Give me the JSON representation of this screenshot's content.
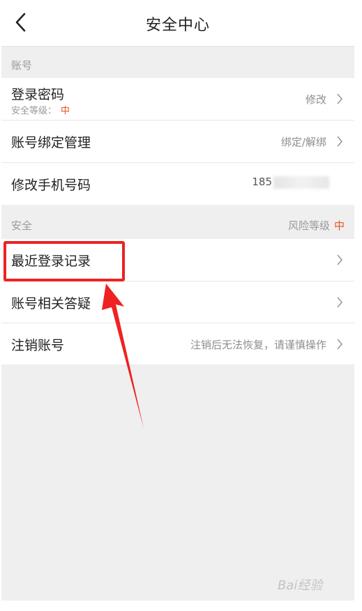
{
  "header": {
    "title": "安全中心"
  },
  "account_section": {
    "label": "账号",
    "rows": [
      {
        "title": "登录密码",
        "sub_label": "安全等级：",
        "sub_level": "中",
        "value": "修改"
      },
      {
        "title": "账号绑定管理",
        "value": "绑定/解绑"
      },
      {
        "title": "修改手机号码",
        "value": "185"
      }
    ]
  },
  "security_section": {
    "label": "安全",
    "risk_label": "风险等级",
    "risk_level": "中",
    "rows": [
      {
        "title": "最近登录记录"
      },
      {
        "title": "账号相关答疑"
      },
      {
        "title": "注销账号",
        "value": "注销后无法恢复，请谨慎操作"
      }
    ]
  },
  "watermark": {
    "text": "Bai经验"
  },
  "colors": {
    "accent": "#e8541e",
    "annotation": "#ee2222",
    "background": "#efeff0"
  },
  "icons": {
    "back": "chevron-left-icon",
    "row_arrow": "chevron-right-icon"
  }
}
